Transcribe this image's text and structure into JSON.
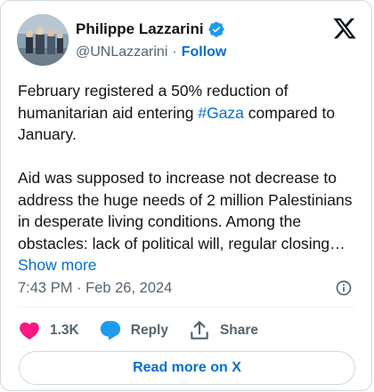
{
  "author": {
    "display_name": "Philippe Lazzarini",
    "handle": "@UNLazzarini",
    "separator": "·",
    "follow_label": "Follow"
  },
  "tweet": {
    "text_part1": "February registered a 50% reduction of humanitarian aid entering ",
    "hashtag": "#Gaza",
    "text_part2": " compared to January.\n\nAid was supposed to increase not decrease to address the huge needs of 2 million Palestinians in desperate living conditions. Among the obstacles: lack of political will, regular closing…",
    "show_more": "Show more",
    "timestamp": "7:43 PM · Feb 26, 2024"
  },
  "actions": {
    "likes": "1.3K",
    "reply_label": "Reply",
    "share_label": "Share"
  },
  "read_more_label": "Read more on X",
  "colors": {
    "accent": "#006fd6",
    "like_pink": "#f91880",
    "reply_blue": "#1d9bf0",
    "verified_blue": "#1d9bf0"
  }
}
